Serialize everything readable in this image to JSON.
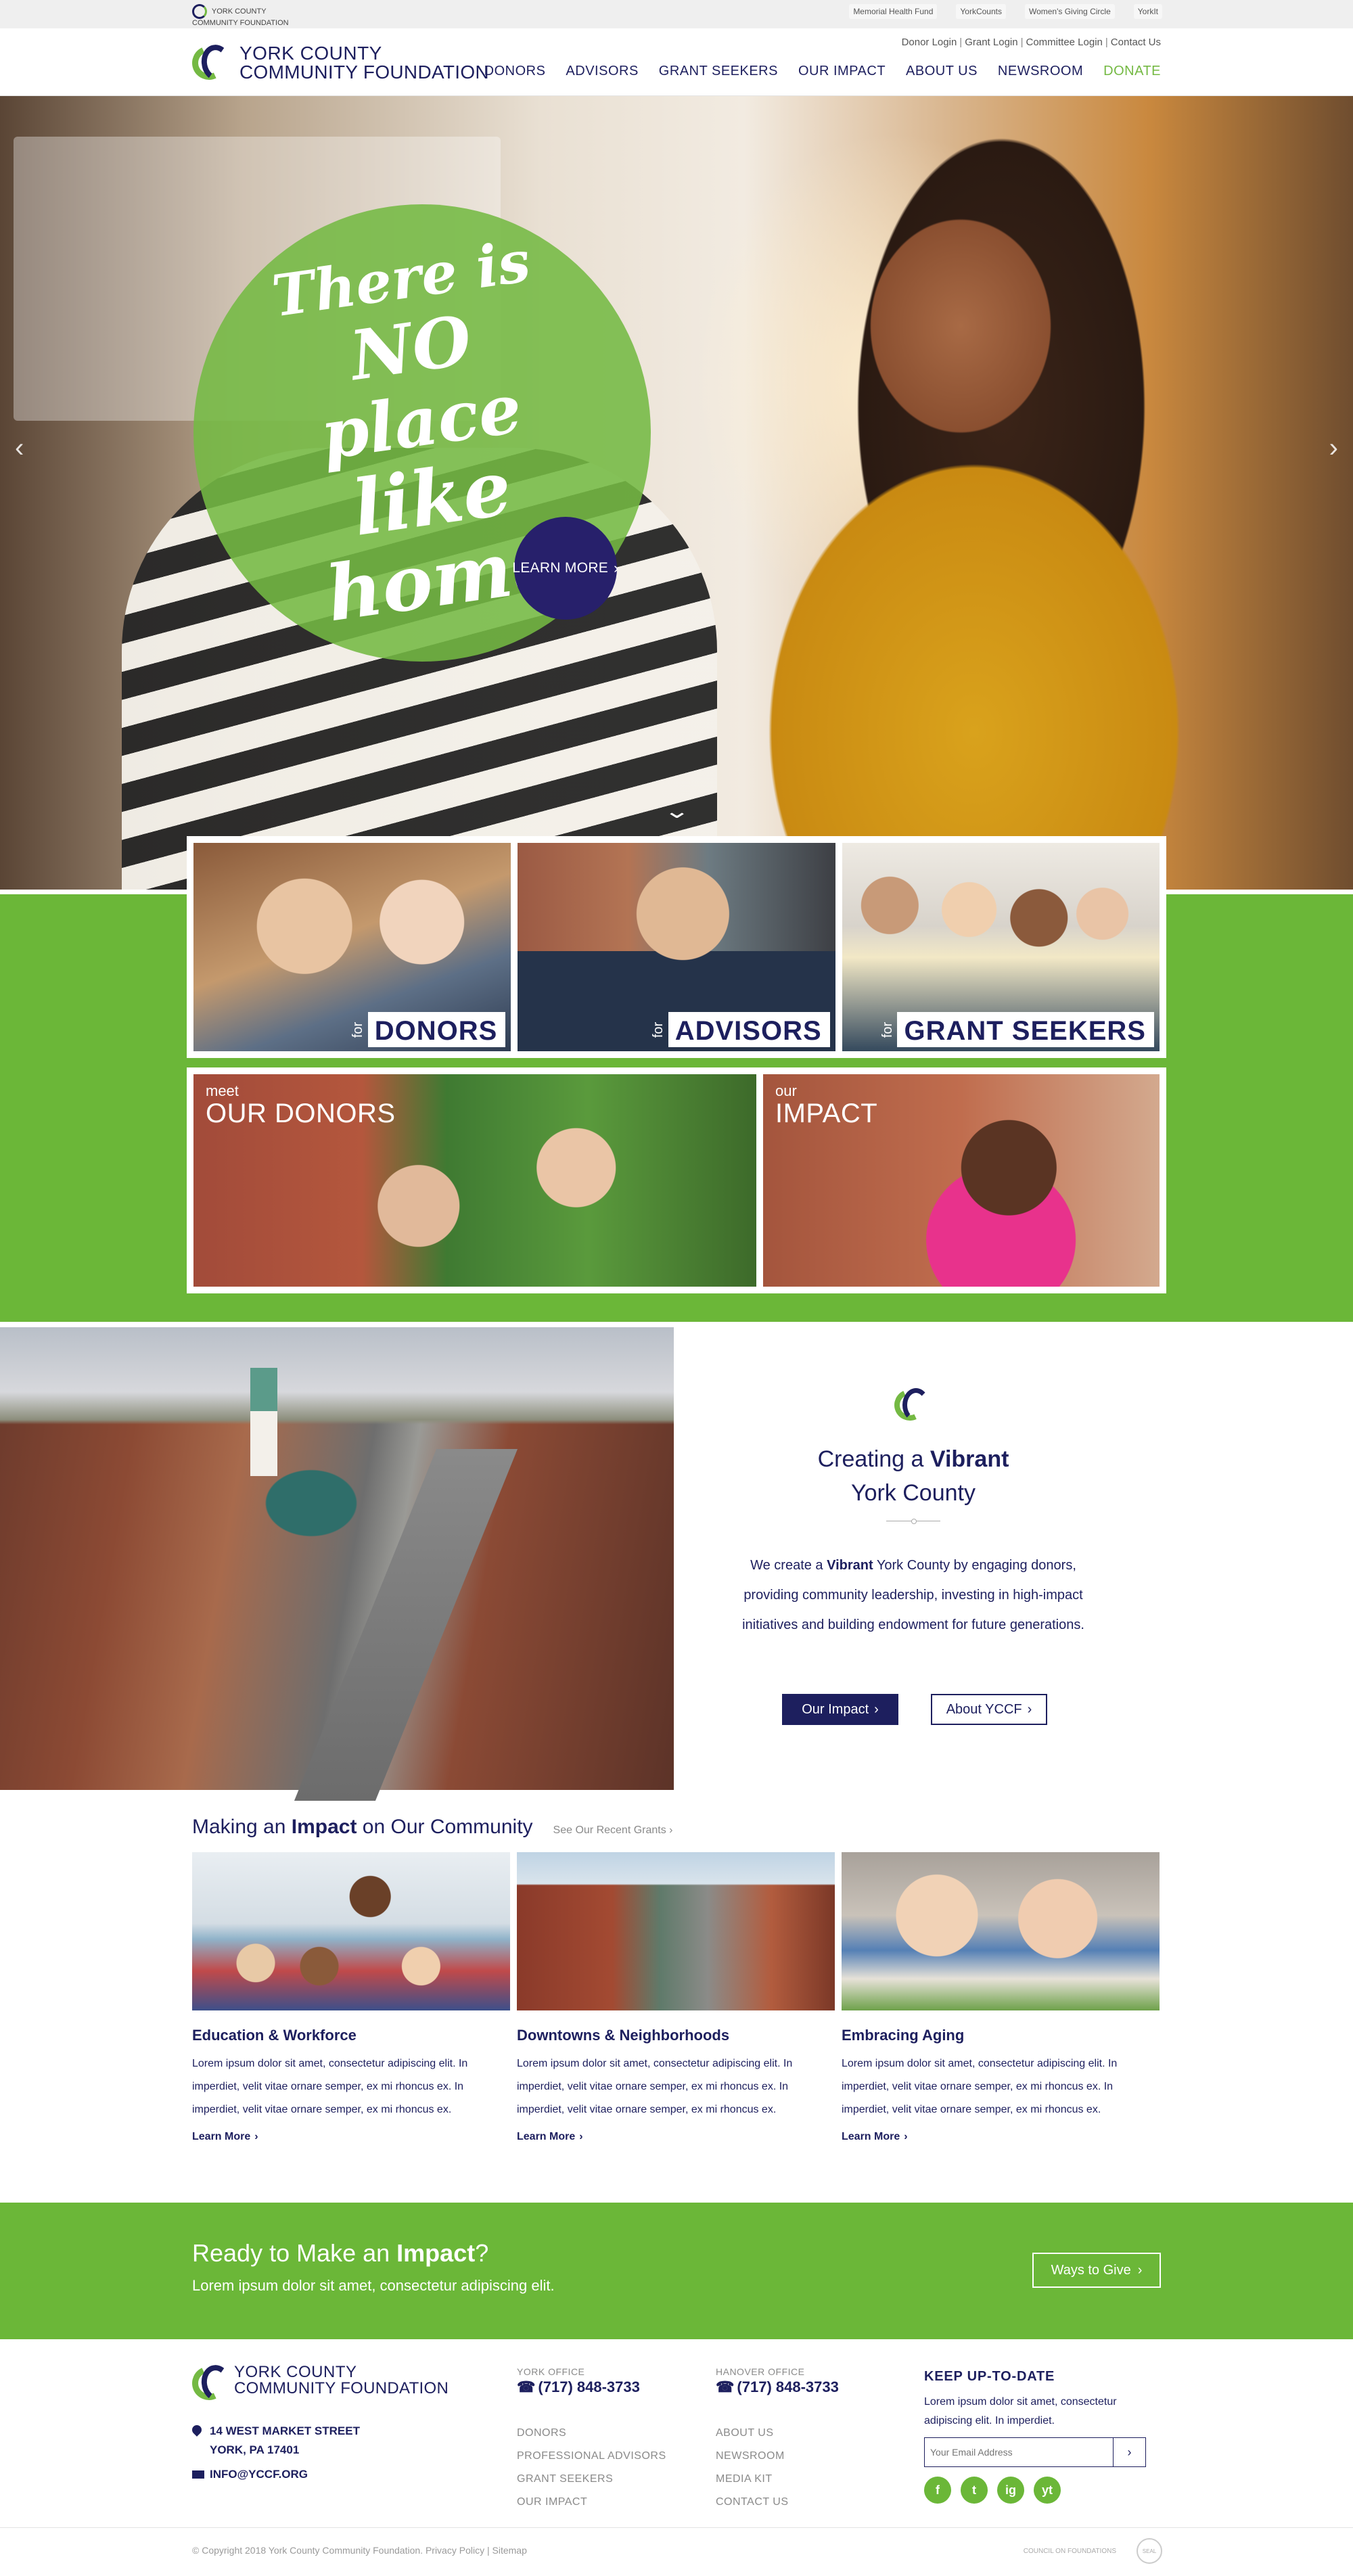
{
  "topstrip": {
    "mini_logo_line1": "YORK COUNTY",
    "mini_logo_line2": "COMMUNITY FOUNDATION",
    "partners": [
      "Memorial Health Fund",
      "YorkCounts",
      "Women's Giving Circle",
      "YorkIt"
    ]
  },
  "utility_links": [
    "Donor Login",
    "Grant Login",
    "Committee Login",
    "Contact Us"
  ],
  "logo": {
    "line1": "YORK COUNTY",
    "line2": "COMMUNITY FOUNDATION"
  },
  "nav": [
    "DONORS",
    "ADVISORS",
    "GRANT SEEKERS",
    "OUR IMPACT",
    "ABOUT US",
    "NEWSROOM",
    "DONATE"
  ],
  "hero": {
    "tagline_1": "There is",
    "tagline_2": "NO place",
    "tagline_3": "like home",
    "cta": "LEARN MORE"
  },
  "tiles": {
    "for": "for",
    "donors": "DONORS",
    "advisors": "ADVISORS",
    "grant_seekers": "GRANT SEEKERS",
    "meet": "meet",
    "our_donors": "OUR DONORS",
    "our": "our",
    "impact": "IMPACT"
  },
  "vibrant": {
    "title_pre": "Creating a ",
    "title_bold": "Vibrant",
    "title_post": "York County",
    "body_pre": "We create a ",
    "body_bold": "Vibrant",
    "body_post": " York County by engaging donors, providing community leadership, investing in high-impact initiatives and building endowment for future generations.",
    "btn_impact": "Our Impact",
    "btn_about": "About YCCF"
  },
  "impact": {
    "title_pre": "Making an ",
    "title_bold": "Impact",
    "title_post": " on Our Community",
    "see_grants": "See Our Recent Grants",
    "cards": [
      {
        "title": "Education & Workforce",
        "body": "Lorem ipsum dolor sit amet, consectetur adipiscing elit. In imperdiet, velit vitae ornare semper, ex mi rhoncus ex. In imperdiet, velit vitae ornare semper, ex mi rhoncus ex.",
        "link": "Learn More"
      },
      {
        "title": "Downtowns & Neighborhoods",
        "body": "Lorem ipsum dolor sit amet, consectetur adipiscing elit. In imperdiet, velit vitae ornare semper, ex mi rhoncus ex. In imperdiet, velit vitae ornare semper, ex mi rhoncus ex.",
        "link": "Learn More"
      },
      {
        "title": "Embracing Aging",
        "body": "Lorem ipsum dolor sit amet, consectetur adipiscing elit. In imperdiet, velit vitae ornare semper, ex mi rhoncus ex. In imperdiet, velit vitae ornare semper, ex mi rhoncus ex.",
        "link": "Learn More"
      }
    ]
  },
  "cta": {
    "title_pre": "Ready to Make an ",
    "title_bold": "Impact",
    "title_post": "?",
    "subtitle": "Lorem ipsum dolor sit amet, consectetur adipiscing elit.",
    "button": "Ways to Give"
  },
  "footer": {
    "logo_line1": "YORK COUNTY",
    "logo_line2": "COMMUNITY FOUNDATION",
    "address_line1": "14 WEST MARKET STREET",
    "address_line2": "YORK, PA 17401",
    "email": "INFO@YCCF.ORG",
    "york_label": "YORK OFFICE",
    "york_phone": "(717) 848-3733",
    "hanover_label": "HANOVER OFFICE",
    "hanover_phone": "(717) 848-3733",
    "links_a": [
      "DONORS",
      "PROFESSIONAL ADVISORS",
      "GRANT SEEKERS",
      "OUR IMPACT"
    ],
    "links_b": [
      "ABOUT US",
      "NEWSROOM",
      "MEDIA KIT",
      "CONTACT US"
    ],
    "newsletter_title": "KEEP UP-TO-DATE",
    "newsletter_text": "Lorem ipsum dolor sit amet, consectetur adipiscing elit. In imperdiet.",
    "email_placeholder": "Your Email Address",
    "social": [
      "f",
      "t",
      "ig",
      "yt"
    ],
    "copyright": "© Copyright 2018 York County Community Foundation. Privacy Policy  |  Sitemap",
    "badge_1": "COUNCIL ON FOUNDATIONS",
    "badge_2": "SEAL"
  },
  "colors": {
    "navy": "#1d1f5e",
    "green": "#6bb738",
    "hero_button": "#27206b"
  }
}
